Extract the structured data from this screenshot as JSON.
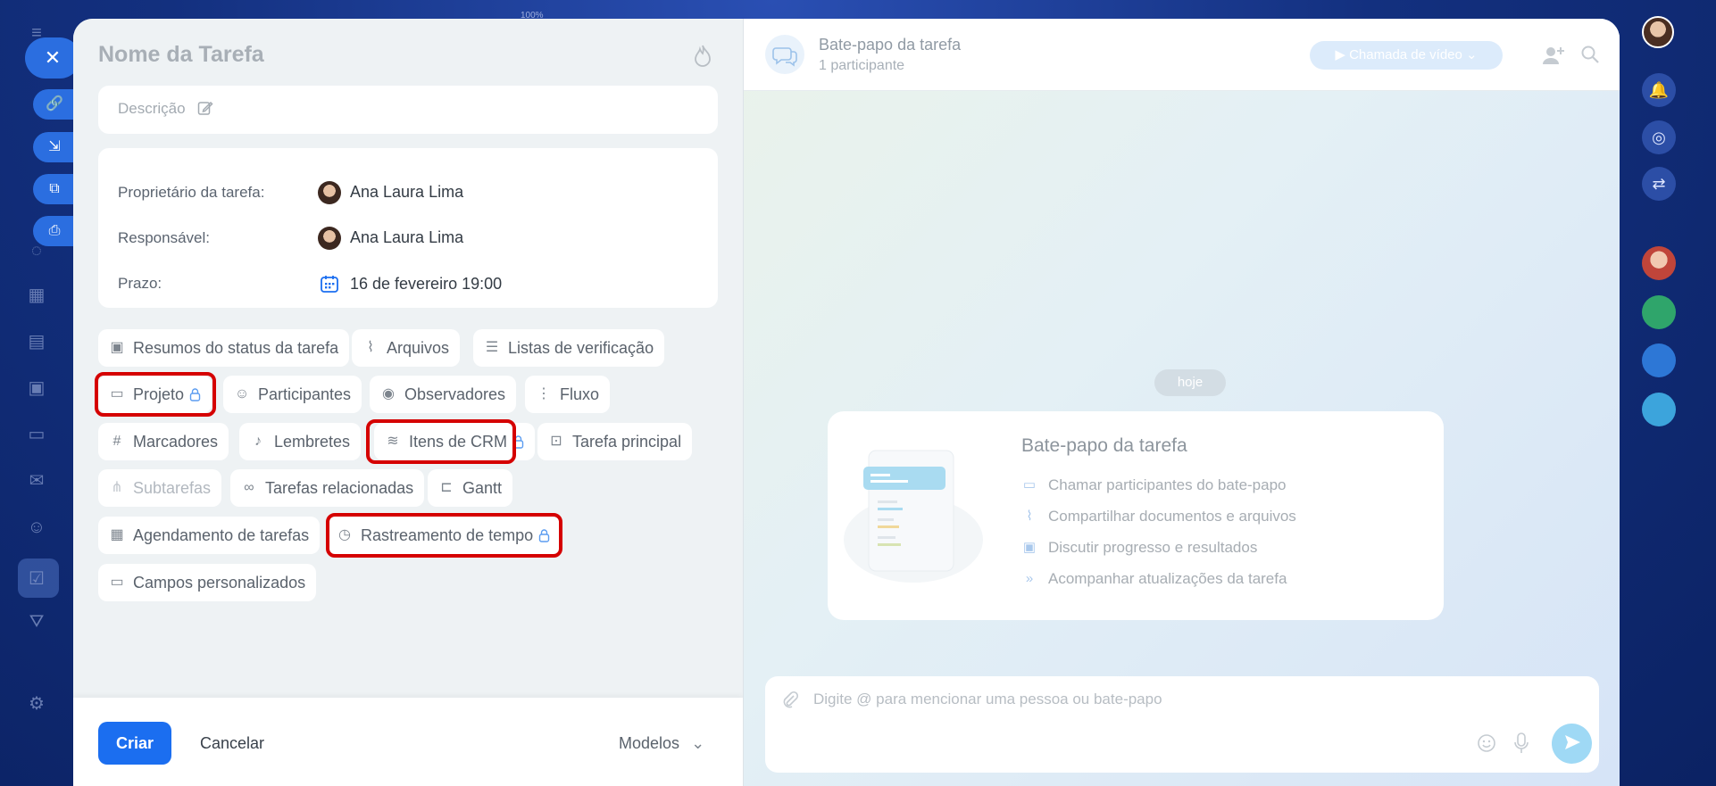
{
  "window": {
    "zoom_text": "100%"
  },
  "side_actions": {
    "close_glyph": "✕",
    "link_glyph": "🔗",
    "minimize_glyph": "⇲",
    "external_glyph": "⧉",
    "print_glyph": "⎙"
  },
  "task": {
    "title": "Nome da Tarefa",
    "description_placeholder": "Descrição",
    "owner_label": "Proprietário da tarefa:",
    "owner_name": "Ana Laura Lima",
    "responsible_label": "Responsável:",
    "responsible_name": "Ana Laura Lima",
    "deadline_label": "Prazo:",
    "deadline_value": "16 de fevereiro 19:00"
  },
  "chips": {
    "status_summaries": "Resumos do status da tarefa",
    "files": "Arquivos",
    "checklists": "Listas de verificação",
    "project": "Projeto",
    "participants": "Participantes",
    "observers": "Observadores",
    "flow": "Fluxo",
    "tags": "Marcadores",
    "reminders": "Lembretes",
    "crm_items": "Itens de CRM",
    "parent_task": "Tarefa principal",
    "subtasks": "Subtarefas",
    "related_tasks": "Tarefas relacionadas",
    "gantt": "Gantt",
    "task_scheduling": "Agendamento de tarefas",
    "time_tracking": "Rastreamento de tempo",
    "custom_fields": "Campos personalizados"
  },
  "footer": {
    "create_label": "Criar",
    "cancel_label": "Cancelar",
    "models_label": "Modelos"
  },
  "chat": {
    "title": "Bate-papo da tarefa",
    "participants_count": "1 participante",
    "video_call_label": "Chamada de vídeo",
    "date_pill": "hoje",
    "card_title": "Bate-papo da tarefa",
    "card_items": [
      "Chamar participantes do bate-papo",
      "Compartilhar documentos e arquivos",
      "Discutir progresso e resultados",
      "Acompanhar atualizações da tarefa"
    ],
    "composer_placeholder": "Digite @ para mencionar uma pessoa ou bate-papo"
  },
  "colors": {
    "accent": "#1b6ef0",
    "highlight": "#d50000",
    "modal_bg": "#eef2f4"
  }
}
